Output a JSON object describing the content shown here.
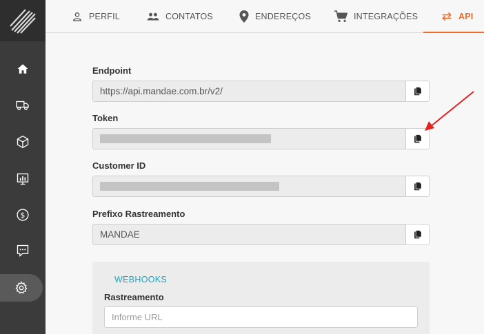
{
  "sidebar": {
    "logo_icon": "stripes-logo-icon",
    "items": [
      {
        "icon": "home-icon"
      },
      {
        "icon": "truck-icon"
      },
      {
        "icon": "package-icon"
      },
      {
        "icon": "chart-monitor-icon"
      },
      {
        "icon": "dollar-icon"
      },
      {
        "icon": "chat-icon"
      },
      {
        "icon": "gear-icon",
        "active": true
      }
    ]
  },
  "tabs": [
    {
      "label": "PERFIL",
      "icon": "user-icon"
    },
    {
      "label": "CONTATOS",
      "icon": "people-icon"
    },
    {
      "label": "ENDEREÇOS",
      "icon": "location-pin-icon"
    },
    {
      "label": "INTEGRAÇÕES",
      "icon": "cart-icon"
    },
    {
      "label": "API",
      "icon": "swap-arrows-icon",
      "active": true
    }
  ],
  "fields": {
    "endpoint": {
      "label": "Endpoint",
      "value": "https://api.mandae.com.br/v2/"
    },
    "token": {
      "label": "Token"
    },
    "customer_id": {
      "label": "Customer ID"
    },
    "prefix": {
      "label": "Prefixo Rastreamento",
      "value": "MANDAE"
    }
  },
  "webhooks": {
    "title": "WEBHOOKS",
    "tracking_label": "Rastreamento",
    "url_placeholder": "Informe URL"
  },
  "colors": {
    "accent": "#f26b2a",
    "webhooks_title": "#1aa6c4",
    "sidebar_bg": "#3b3b3b",
    "annotation_arrow": "#e52222"
  }
}
